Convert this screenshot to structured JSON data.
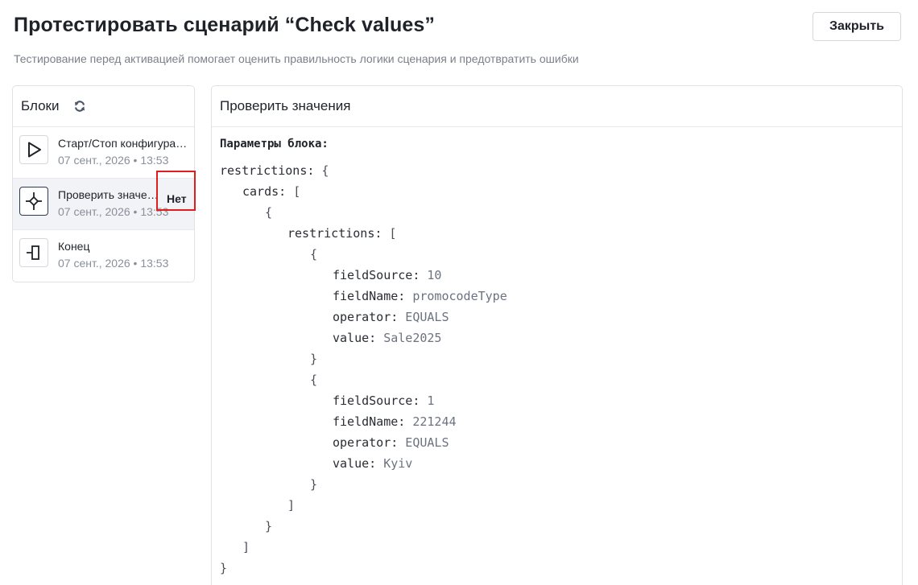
{
  "header": {
    "title": "Протестировать сценарий “Check values”",
    "subtitle": "Тестирование перед активацией помогает оценить правильность логики сценария и предотвратить ошибки",
    "close_label": "Закрыть"
  },
  "blocks": {
    "title": "Блоки",
    "items": [
      {
        "name": "Старт/Стоп конфигурации",
        "date": "07 сент., 2026 • 13:53",
        "icon": "play-icon",
        "status": ""
      },
      {
        "name": "Проверить значения",
        "date": "07 сент., 2026 • 13:53",
        "icon": "condition-icon",
        "status": "Нет"
      },
      {
        "name": "Конец",
        "date": "07 сент., 2026 • 13:53",
        "icon": "end-icon",
        "status": ""
      }
    ]
  },
  "details": {
    "title": "Проверить значения",
    "params_label": "Параметры блока:",
    "code_lines": [
      {
        "indent": 0,
        "key": "restrictions:",
        "punct": " {",
        "value": ""
      },
      {
        "indent": 1,
        "key": "cards:",
        "punct": " [",
        "value": ""
      },
      {
        "indent": 2,
        "key": "",
        "punct": "{",
        "value": ""
      },
      {
        "indent": 3,
        "key": "restrictions:",
        "punct": " [",
        "value": ""
      },
      {
        "indent": 4,
        "key": "",
        "punct": "{",
        "value": ""
      },
      {
        "indent": 5,
        "key": "fieldSource:",
        "punct": "",
        "value": " 10"
      },
      {
        "indent": 5,
        "key": "fieldName:",
        "punct": "",
        "value": " promocodeType"
      },
      {
        "indent": 5,
        "key": "operator:",
        "punct": "",
        "value": " EQUALS"
      },
      {
        "indent": 5,
        "key": "value:",
        "punct": "",
        "value": " Sale2025"
      },
      {
        "indent": 4,
        "key": "",
        "punct": "}",
        "value": ""
      },
      {
        "indent": 4,
        "key": "",
        "punct": "{",
        "value": ""
      },
      {
        "indent": 5,
        "key": "fieldSource:",
        "punct": "",
        "value": " 1"
      },
      {
        "indent": 5,
        "key": "fieldName:",
        "punct": "",
        "value": " 221244"
      },
      {
        "indent": 5,
        "key": "operator:",
        "punct": "",
        "value": " EQUALS"
      },
      {
        "indent": 5,
        "key": "value:",
        "punct": "",
        "value": " Kyiv"
      },
      {
        "indent": 4,
        "key": "",
        "punct": "}",
        "value": ""
      },
      {
        "indent": 3,
        "key": "",
        "punct": "]",
        "value": ""
      },
      {
        "indent": 2,
        "key": "",
        "punct": "}",
        "value": ""
      },
      {
        "indent": 1,
        "key": "",
        "punct": "]",
        "value": ""
      },
      {
        "indent": 0,
        "key": "",
        "punct": "}",
        "value": ""
      }
    ]
  },
  "colors": {
    "highlight": "#e11d1d",
    "active_row": "#f1f3f6"
  }
}
